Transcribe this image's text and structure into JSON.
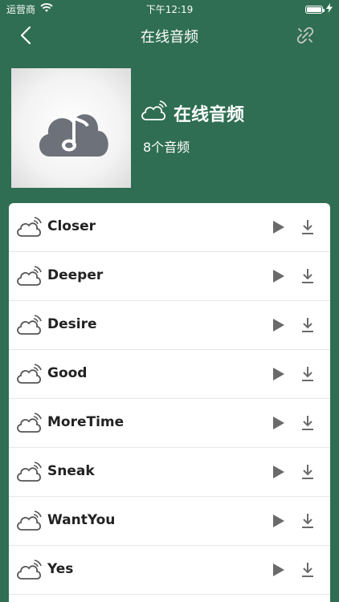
{
  "status_bar": {
    "carrier": "运营商",
    "time": "下午12:19",
    "icons": [
      "wifi-icon",
      "battery-icon",
      "charging-icon"
    ]
  },
  "nav": {
    "title": "在线音频",
    "left_icon": "back-chevron-icon",
    "right_icon": "link-icon"
  },
  "album": {
    "title": "在线音频",
    "count": "8个音频",
    "cover_icon": "cloud-music-note-icon",
    "title_icon": "cloud-signal-icon"
  },
  "tracks": [
    {
      "name": "Closer"
    },
    {
      "name": "Deeper"
    },
    {
      "name": "Desire"
    },
    {
      "name": "Good"
    },
    {
      "name": "MoreTime"
    },
    {
      "name": "Sneak"
    },
    {
      "name": "WantYou"
    },
    {
      "name": "Yes"
    }
  ],
  "colors": {
    "background": "#2f6e52",
    "list_background": "#ffffff",
    "icon_gray": "#5f5f5f"
  }
}
